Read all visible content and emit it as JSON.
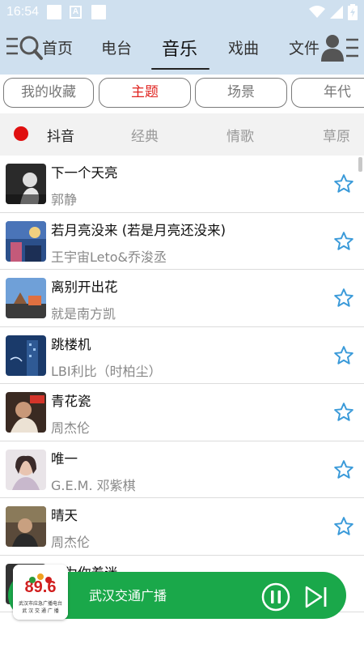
{
  "status_bar": {
    "time": "16:54",
    "a_badge": "A"
  },
  "nav": {
    "tabs": [
      {
        "label": "首页"
      },
      {
        "label": "电台"
      },
      {
        "label": "音乐"
      },
      {
        "label": "戏曲"
      },
      {
        "label": "文件"
      }
    ],
    "active": "音乐"
  },
  "categories": [
    {
      "label": "我的收藏"
    },
    {
      "label": "主题"
    },
    {
      "label": "场景"
    },
    {
      "label": "年代"
    }
  ],
  "active_category": "主题",
  "subtabs": [
    {
      "label": "抖音"
    },
    {
      "label": "经典"
    },
    {
      "label": "情歌"
    },
    {
      "label": "草原"
    }
  ],
  "active_subtab": "抖音",
  "songs": [
    {
      "title": "下一个天亮",
      "artist": "郭静",
      "favorited": false
    },
    {
      "title": "若月亮没来 (若是月亮还没来)",
      "artist": "王宇宙Leto&乔浚丞",
      "favorited": false
    },
    {
      "title": "离别开出花",
      "artist": "就是南方凯",
      "favorited": false
    },
    {
      "title": "跳楼机",
      "artist": "LBI利比（时柏尘）",
      "favorited": false
    },
    {
      "title": "青花瓷",
      "artist": "周杰伦",
      "favorited": false
    },
    {
      "title": "唯一",
      "artist": "G.E.M. 邓紫棋",
      "favorited": false
    },
    {
      "title": "晴天",
      "artist": "周杰伦",
      "favorited": false
    },
    {
      "title": "只为你着迷",
      "artist": "",
      "favorited": false
    }
  ],
  "player": {
    "station": "武汉交通广播",
    "logo_number": "89.6",
    "logo_caption_line1": "武汉市应急广播电台",
    "logo_caption_line2": "武 汉 交 通 广 播",
    "state": "playing"
  },
  "colors": {
    "header_bg": "#cfe0ef",
    "accent_red": "#e0231f",
    "player_green": "#1aa84a",
    "star_blue": "#3a9ad9"
  }
}
